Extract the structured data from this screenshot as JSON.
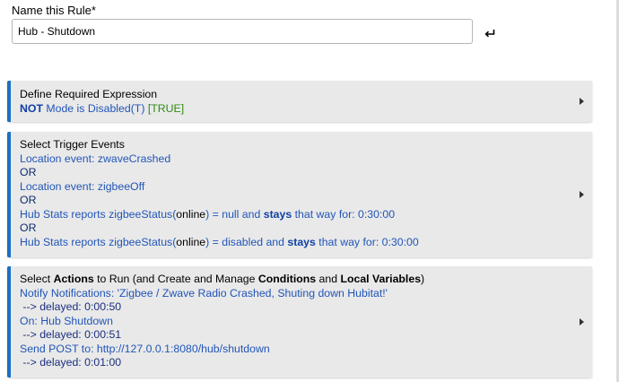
{
  "rule_name": {
    "label": "Name this Rule*",
    "value": "Hub - Shutdown",
    "enter_icon": "enter-return-icon"
  },
  "expression_panel": {
    "title": "Define Required Expression",
    "not_keyword": "NOT",
    "condition": " Mode is Disabled(T) ",
    "result": "[TRUE]",
    "expand_icon": "triangle-right-icon"
  },
  "trigger_panel": {
    "title": "Select Trigger Events",
    "event1": "Location event: zwaveCrashed",
    "or1": "OR",
    "event2": "Location event: zigbeeOff",
    "or2": "OR",
    "event3_prefix": "Hub Stats reports zigbeeStatus(",
    "event3_param": "online",
    "event3_middle": ") = null and ",
    "event3_stays": "stays",
    "event3_suffix": " that way for: 0:30:00",
    "or3": "OR",
    "event4_prefix": "Hub Stats reports zigbeeStatus(",
    "event4_param": "online",
    "event4_middle": ") = disabled and ",
    "event4_stays": "stays",
    "event4_suffix": " that way for: 0:30:00",
    "expand_icon": "triangle-right-icon"
  },
  "actions_panel": {
    "title_part1": "Select ",
    "title_actions": "Actions",
    "title_part2": " to Run (and Create and Manage ",
    "title_conditions": "Conditions",
    "title_part3": " and ",
    "title_local_vars": "Local Variables",
    "title_part4": ")",
    "action1": "Notify Notifications: 'Zigbee / Zwave Radio Crashed, Shuting down Hubitat!'",
    "action1_delay": " --> delayed: 0:00:50",
    "action2": "On: Hub Shutdown",
    "action2_delay": " --> delayed: 0:00:51",
    "action3": "Send POST to: http://127.0.0.1:8080/hub/shutdown",
    "action3_delay": " --> delayed: 0:01:00",
    "expand_icon": "triangle-right-icon"
  },
  "colors": {
    "accent_border": "#1a6fc4",
    "link_blue": "#2155b8",
    "true_green": "#2e8b16",
    "panel_bg": "#e9e9e9"
  }
}
